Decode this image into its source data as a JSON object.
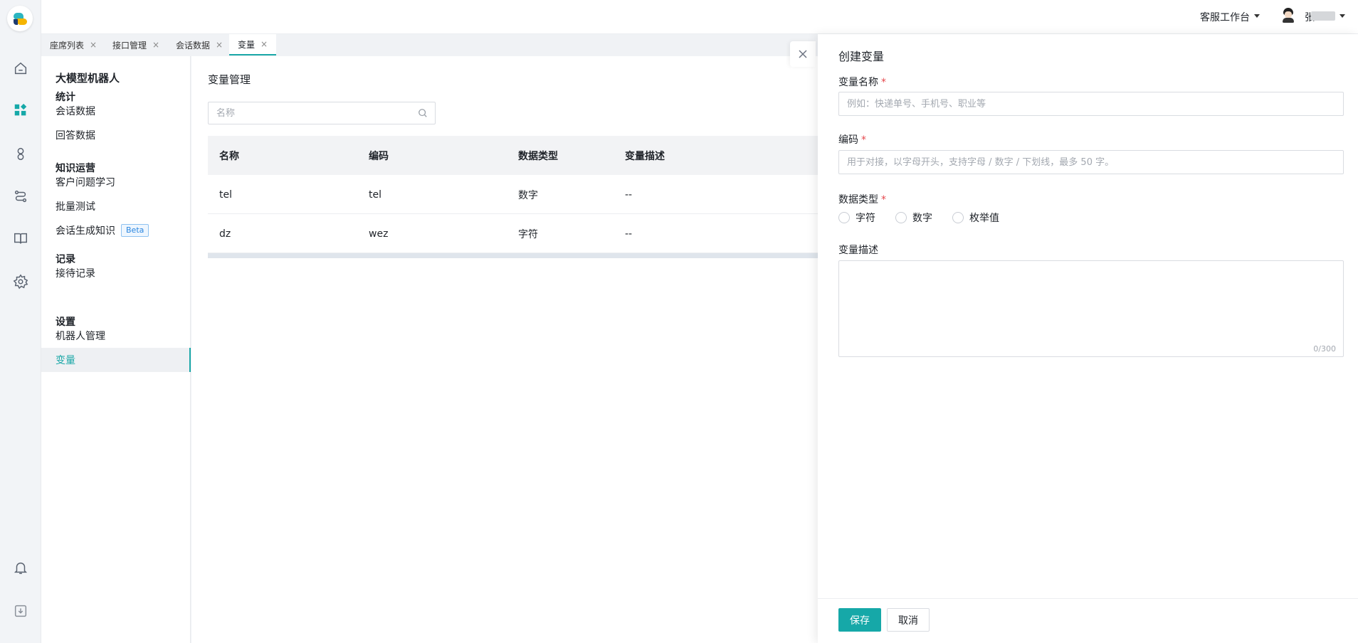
{
  "header": {
    "workbench_label": "客服工作台",
    "user_name_initial": "张"
  },
  "tabs": [
    {
      "label": "座席列表",
      "close": "×"
    },
    {
      "label": "接口管理",
      "close": "×"
    },
    {
      "label": "会话数据",
      "close": "×"
    },
    {
      "label": "变量",
      "close": "×"
    }
  ],
  "sidenav": {
    "title": "大模型机器人",
    "groups": [
      {
        "label": "统计",
        "items": [
          "会话数据",
          "回答数据"
        ]
      },
      {
        "label": "知识运营",
        "items": [
          "客户问题学习",
          "批量测试",
          "会话生成知识"
        ]
      },
      {
        "label": "记录",
        "items": [
          "接待记录"
        ]
      },
      {
        "label": "设置",
        "items": [
          "机器人管理",
          "变量"
        ]
      }
    ],
    "beta_badge": "Beta"
  },
  "main": {
    "title": "变量管理",
    "search_placeholder": "名称",
    "columns": [
      "名称",
      "编码",
      "数据类型",
      "变量描述"
    ],
    "rows": [
      [
        "tel",
        "tel",
        "数字",
        "--"
      ],
      [
        "dz",
        "wez",
        "字符",
        "--"
      ]
    ]
  },
  "drawer": {
    "title": "创建变量",
    "name_label": "变量名称",
    "name_placeholder": "例如：快递单号、手机号、职业等",
    "code_label": "编码",
    "code_placeholder": "用于对接，以字母开头，支持字母 / 数字 / 下划线，最多 50 字。",
    "type_label": "数据类型",
    "type_options": [
      "字符",
      "数字",
      "枚举值"
    ],
    "desc_label": "变量描述",
    "desc_counter": "0/300",
    "required_mark": "*",
    "save_label": "保存",
    "cancel_label": "取消"
  },
  "colors": {
    "accent": "#16a8a8",
    "required": "#e5484d"
  }
}
